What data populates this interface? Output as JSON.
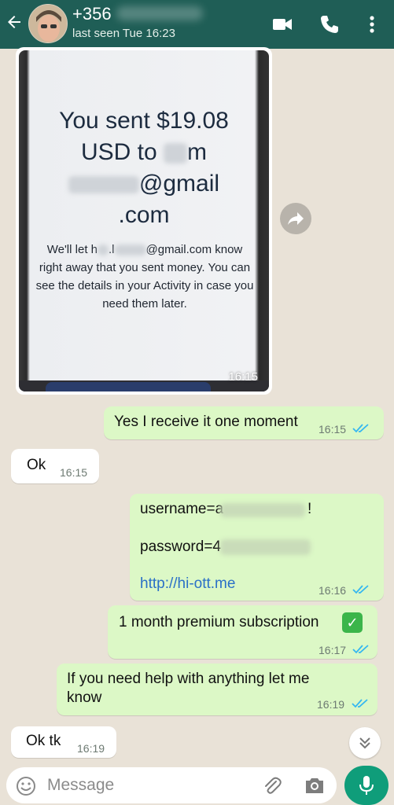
{
  "header": {
    "contact_name": "+356",
    "last_seen": "last seen Tue 16:23"
  },
  "image_message": {
    "title_line1": "You sent $19.08",
    "title_line2a": "USD to ",
    "title_line2b": "m",
    "title_line3": "@gmail",
    "title_line4": ".com",
    "body_a": "We'll let h",
    "body_b": ".l",
    "body_c": "@gmail.com",
    "body_rest": "know right away that you sent money. You can see the details in your Activity in case you need them later.",
    "time": "16:15"
  },
  "messages": [
    {
      "text": "Yes I receive it one moment",
      "time": "16:15",
      "dir": "out"
    },
    {
      "text": "Ok",
      "time": "16:15",
      "dir": "in"
    },
    {
      "username": "username=a",
      "username_end": "!",
      "password": "password=4",
      "link": "http://hi-ott.me",
      "time": "16:16",
      "dir": "out"
    },
    {
      "text": "1 month premium subscription",
      "emoji": "✅",
      "time": "16:17",
      "dir": "out"
    },
    {
      "text": "If you need help with anything let me know",
      "time": "16:19",
      "dir": "out"
    },
    {
      "text": "Ok tk",
      "time": "16:19",
      "dir": "in"
    }
  ],
  "composer": {
    "placeholder": "Message"
  },
  "colors": {
    "header": "#1f5e56",
    "outgoing_bubble": "#dcf8c6",
    "incoming_bubble": "#ffffff",
    "read_ticks": "#34b7f1",
    "mic_button": "#0f9d7a"
  },
  "icons": [
    "back-arrow-icon",
    "video-call-icon",
    "phone-icon",
    "more-vert-icon",
    "forward-icon",
    "double-tick-icon",
    "scroll-down-icon",
    "emoji-icon",
    "attach-icon",
    "camera-icon",
    "mic-icon"
  ]
}
